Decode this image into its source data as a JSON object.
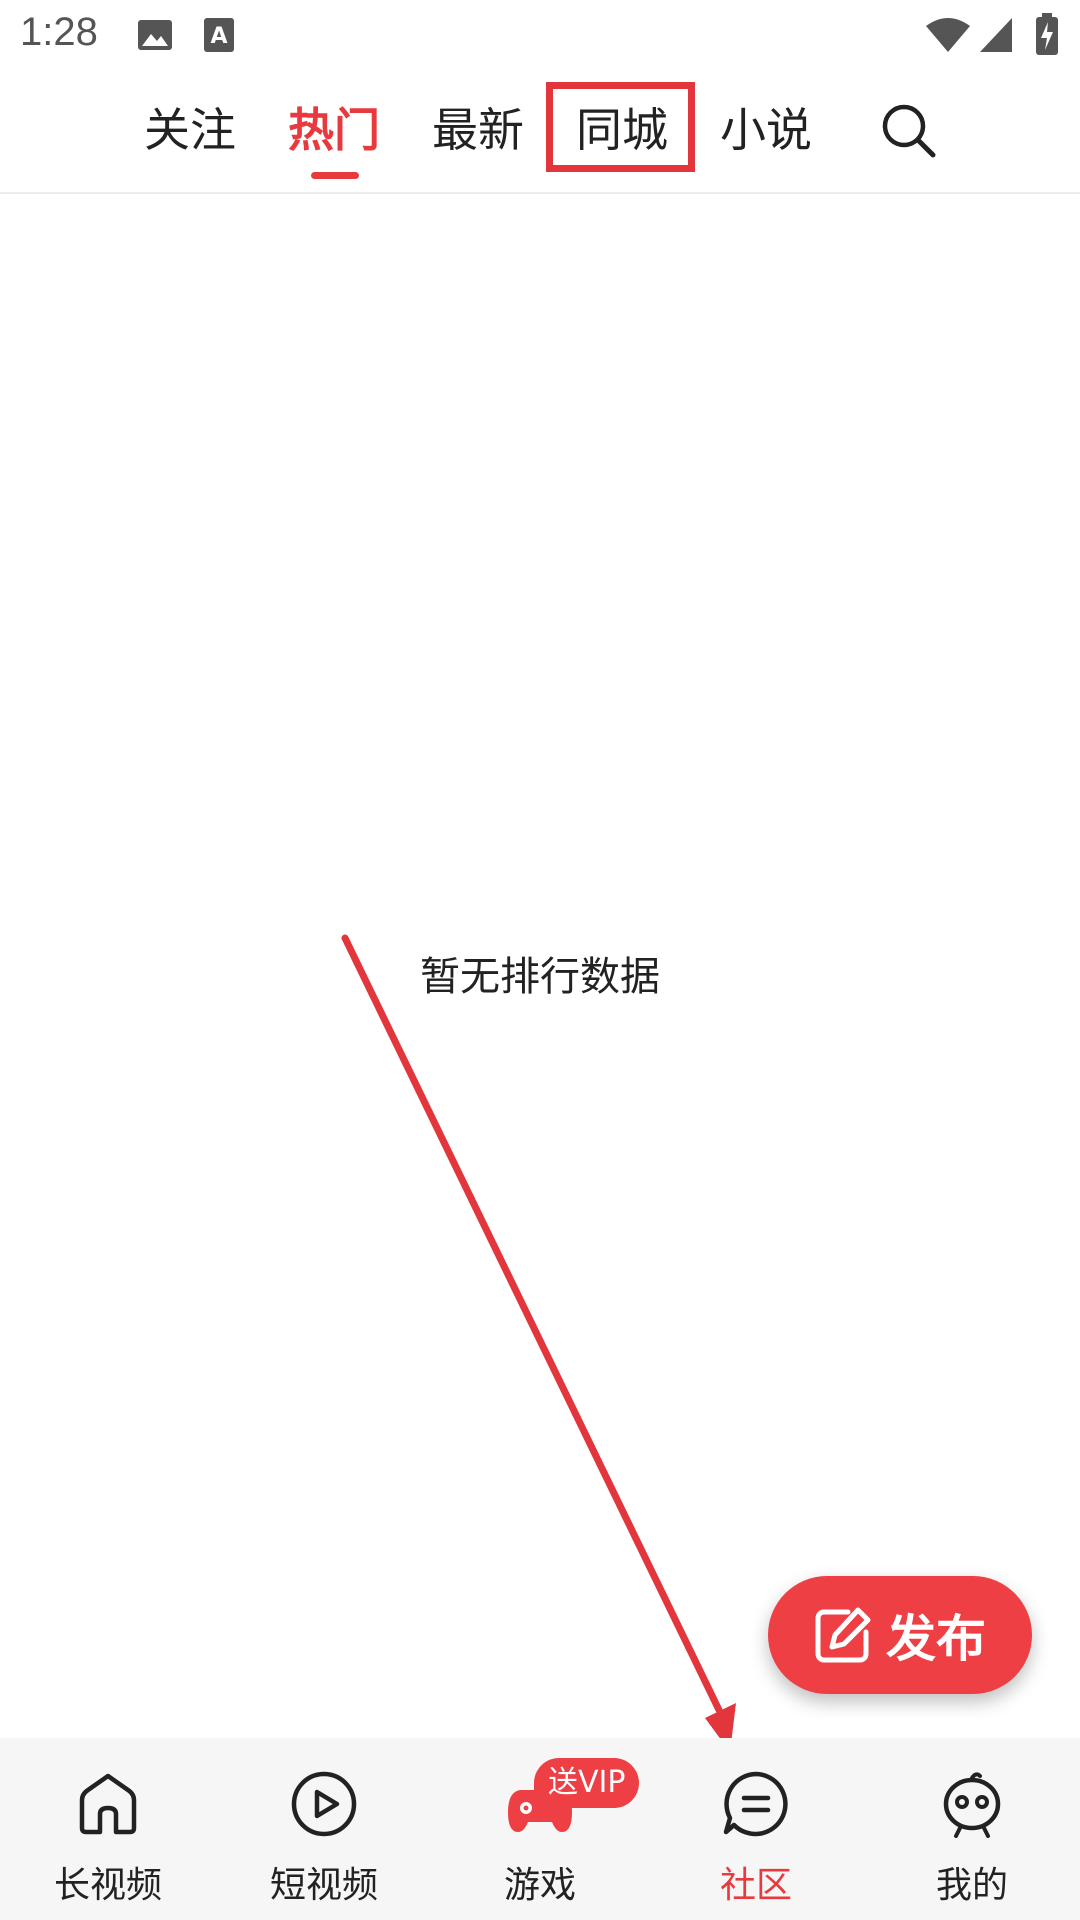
{
  "status_bar": {
    "time": "1:28"
  },
  "top_tabs": [
    {
      "label": "关注"
    },
    {
      "label": "热门"
    },
    {
      "label": "最新"
    },
    {
      "label": "同城"
    },
    {
      "label": "小说"
    }
  ],
  "active_tab_index": 1,
  "empty_state": {
    "text": "暂无排行数据"
  },
  "publish_button": {
    "label": "发布"
  },
  "bottom_nav": {
    "items": [
      {
        "label": "长视频",
        "icon": "home-icon"
      },
      {
        "label": "短视频",
        "icon": "play-icon"
      },
      {
        "label": "游戏",
        "icon": "gamepad-icon",
        "badge": "送VIP"
      },
      {
        "label": "社区",
        "icon": "chat-icon"
      },
      {
        "label": "我的",
        "icon": "robot-avatar-icon"
      }
    ],
    "active_index": 3
  },
  "colors": {
    "accent": "#e8393f",
    "annotation": "#e3353c"
  }
}
